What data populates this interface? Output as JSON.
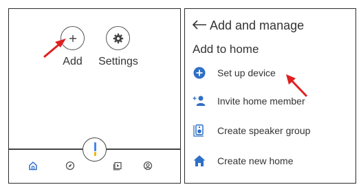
{
  "left_panel": {
    "add_label": "Add",
    "settings_label": "Settings",
    "nav": [
      "home-icon",
      "explore-icon",
      "media-icon",
      "account-icon"
    ]
  },
  "right_panel": {
    "title": "Add and manage",
    "section": "Add to home",
    "items": [
      {
        "label": "Set up device",
        "icon": "add-circle-icon"
      },
      {
        "label": "Invite home member",
        "icon": "add-person-icon"
      },
      {
        "label": "Create speaker group",
        "icon": "speaker-icon"
      },
      {
        "label": "Create new home",
        "icon": "house-icon"
      }
    ]
  },
  "colors": {
    "accent": "#2f6fc6",
    "annotation_arrow": "#e02020",
    "mic_blue": "#4285f4",
    "mic_yellow": "#f4b400"
  }
}
